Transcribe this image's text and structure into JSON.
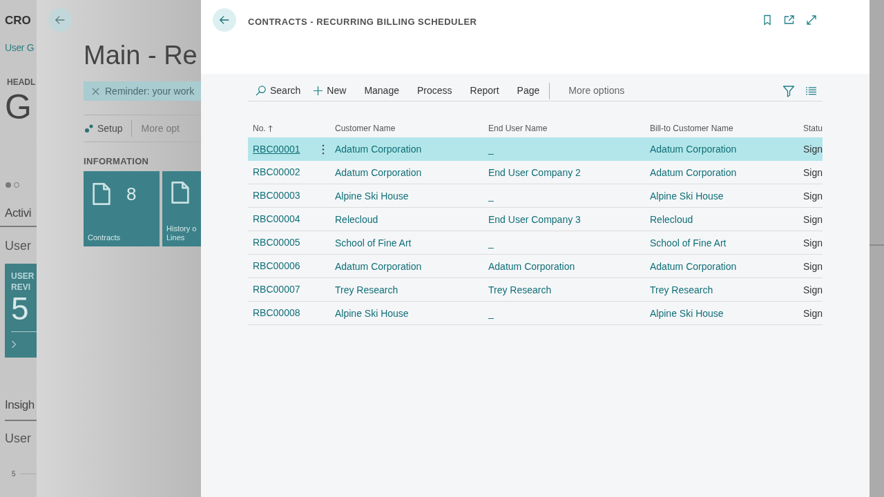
{
  "background_page": {
    "company": "CRO",
    "link": "User G",
    "headline_label": "HEADL",
    "headline": "G",
    "pager": [
      {
        "selected": true
      },
      {
        "selected": false
      }
    ],
    "activities_tab": "Activi",
    "user_heading": "User",
    "tile": {
      "title_lines": [
        "USER",
        "REVI"
      ],
      "count": "5"
    },
    "insights_tab": "Insigh",
    "users_heading": "User",
    "axis_tick": "5"
  },
  "main_page": {
    "title": "Main - Re",
    "reminder": "Reminder: your work",
    "actions": [
      "Setup",
      "More opt"
    ],
    "section": "INFORMATION",
    "tiles": [
      {
        "label_lines": [
          "Contracts"
        ],
        "count": "8"
      },
      {
        "label_lines": [
          "History o",
          "Lines"
        ]
      }
    ]
  },
  "dialog": {
    "title": "CONTRACTS - RECURRING BILLING SCHEDULER",
    "actions": [
      {
        "label": "Search"
      },
      {
        "label": "New"
      },
      {
        "label": "Manage"
      },
      {
        "label": "Process"
      },
      {
        "label": "Report"
      },
      {
        "label": "Page"
      }
    ],
    "more_options": "More options",
    "columns": [
      {
        "label": "No.",
        "sorted": true
      },
      {
        "label": "Customer Name",
        "sorted": false
      },
      {
        "label": "End User Name",
        "sorted": false
      },
      {
        "label": "Bill-to Customer Name",
        "sorted": false
      },
      {
        "label": "Statu",
        "sorted": false
      }
    ],
    "rows": [
      {
        "no": "RBC00001",
        "customer": "Adatum Corporation",
        "end_user": "_",
        "bill_to": "Adatum Corporation",
        "status": "Sign",
        "selected": true
      },
      {
        "no": "RBC00002",
        "customer": "Adatum Corporation",
        "end_user": "End User Company 2",
        "bill_to": "Adatum Corporation",
        "status": "Sign",
        "selected": false
      },
      {
        "no": "RBC00003",
        "customer": "Alpine Ski House",
        "end_user": "_",
        "bill_to": "Alpine Ski House",
        "status": "Sign",
        "selected": false
      },
      {
        "no": "RBC00004",
        "customer": "Relecloud",
        "end_user": "End User Company 3",
        "bill_to": "Relecloud",
        "status": "Sign",
        "selected": false
      },
      {
        "no": "RBC00005",
        "customer": "School of Fine Art",
        "end_user": "_",
        "bill_to": "School of Fine Art",
        "status": "Sign",
        "selected": false
      },
      {
        "no": "RBC00006",
        "customer": "Adatum Corporation",
        "end_user": "Adatum Corporation",
        "bill_to": "Adatum Corporation",
        "status": "Sign",
        "selected": false
      },
      {
        "no": "RBC00007",
        "customer": "Trey Research",
        "end_user": "Trey Research",
        "bill_to": "Trey Research",
        "status": "Sign",
        "selected": false
      },
      {
        "no": "RBC00008",
        "customer": "Alpine Ski House",
        "end_user": "_",
        "bill_to": "Alpine Ski House",
        "status": "Sign",
        "selected": false
      }
    ]
  }
}
